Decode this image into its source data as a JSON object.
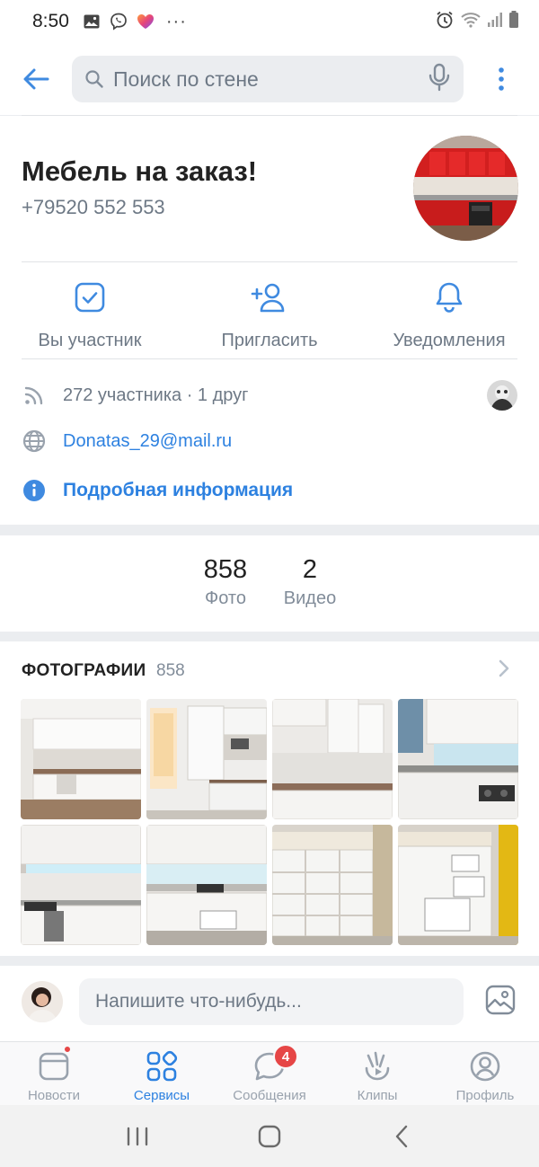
{
  "status_bar": {
    "time": "8:50",
    "extra": "···"
  },
  "search": {
    "placeholder": "Поиск по стене"
  },
  "group": {
    "title": "Мебель на заказ!",
    "phone": "+79520 552 553"
  },
  "actions": [
    {
      "label": "Вы участник",
      "icon": "check-square-icon"
    },
    {
      "label": "Пригласить",
      "icon": "add-person-icon"
    },
    {
      "label": "Уведомления",
      "icon": "bell-icon"
    }
  ],
  "info": {
    "members": "272 участника · 1 друг",
    "email": "Donatas_29@mail.ru",
    "details": "Подробная информация"
  },
  "counters": [
    {
      "value": "858",
      "caption": "Фото"
    },
    {
      "value": "2",
      "caption": "Видео"
    }
  ],
  "photos": {
    "title": "ФОТОГРАФИИ",
    "count": "858"
  },
  "composer": {
    "placeholder": "Напишите что-нибудь..."
  },
  "tabs": [
    {
      "label": "Новости",
      "icon": "news-icon"
    },
    {
      "label": "Сервисы",
      "icon": "services-icon",
      "active": true
    },
    {
      "label": "Сообщения",
      "icon": "messages-icon",
      "badge": "4"
    },
    {
      "label": "Клипы",
      "icon": "clips-icon"
    },
    {
      "label": "Профиль",
      "icon": "profile-icon"
    }
  ],
  "colors": {
    "accent": "#2d81e0",
    "icon_blue": "#3f8ae0",
    "badge_red": "#e64646",
    "secondary_text": "#6d7885"
  }
}
